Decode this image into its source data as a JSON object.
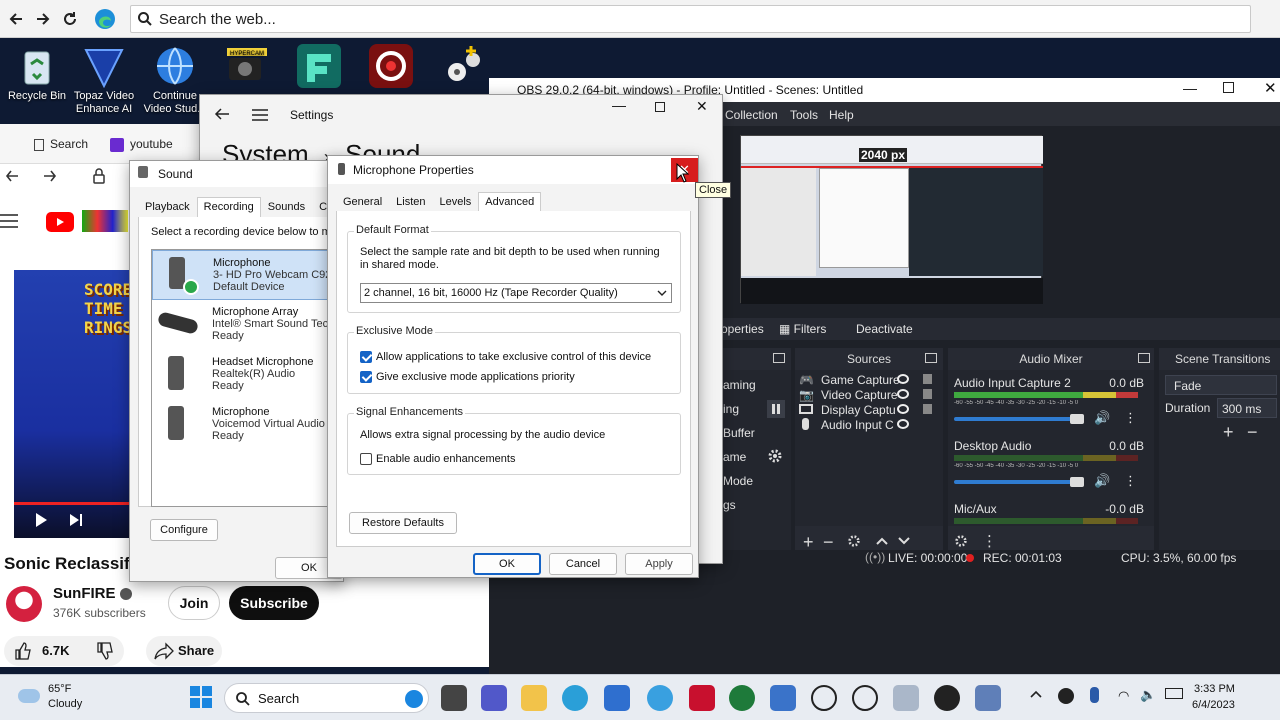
{
  "browser": {
    "search_placeholder": "Search the web..."
  },
  "desktop_icons": [
    {
      "label": "Recycle Bin"
    },
    {
      "label": "Topaz Video Enhance AI"
    },
    {
      "label": "Continue Video Stud..."
    },
    {
      "label": "HYPERCAM"
    },
    {
      "label": ""
    },
    {
      "label": ""
    },
    {
      "label": ""
    }
  ],
  "youtube": {
    "tab_search": "Search",
    "tab_youtube": "youtube",
    "video_title": "Sonic Reclassifi",
    "score_lines": [
      "SCORE",
      "TIME",
      "RINGS"
    ],
    "channel_name": "SunFIRE",
    "subscribers": "376K subscribers",
    "join_label": "Join",
    "subscribe_label": "Subscribe",
    "likes": "6.7K",
    "share_label": "Share"
  },
  "settings": {
    "title": "Settings",
    "breadcrumb_system": "System",
    "breadcrumb_sound": "Sound"
  },
  "sound_dialog": {
    "title": "Sound",
    "tabs": [
      "Playback",
      "Recording",
      "Sounds",
      "Commu"
    ],
    "instruction": "Select a recording device below to m",
    "devices": [
      {
        "name": "Microphone",
        "line2": "3- HD Pro Webcam C920",
        "status": "Default Device"
      },
      {
        "name": "Microphone Array",
        "line2": "Intel® Smart Sound Tec",
        "status": "Ready"
      },
      {
        "name": "Headset Microphone",
        "line2": "Realtek(R) Audio",
        "status": "Ready"
      },
      {
        "name": "Microphone",
        "line2": "Voicemod Virtual Audio",
        "status": "Ready"
      }
    ],
    "configure_label": "Configure",
    "ok_label": "OK"
  },
  "mic_props": {
    "title": "Microphone Properties",
    "close_tooltip": "Close",
    "tabs": [
      "General",
      "Listen",
      "Levels",
      "Advanced"
    ],
    "default_format_title": "Default Format",
    "default_format_desc": "Select the sample rate and bit depth to be used when running in shared mode.",
    "format_value": "2 channel, 16 bit, 16000 Hz (Tape Recorder Quality)",
    "exclusive_title": "Exclusive Mode",
    "exclusive_opt1": "Allow applications to take exclusive control of this device",
    "exclusive_opt2": "Give exclusive mode applications priority",
    "signal_title": "Signal Enhancements",
    "signal_desc": "Allows extra signal processing by the audio device",
    "signal_opt": "Enable audio enhancements",
    "restore_label": "Restore Defaults",
    "ok_label": "OK",
    "cancel_label": "Cancel",
    "apply_label": "Apply"
  },
  "obs": {
    "title": "OBS 29.0.2 (64-bit, windows) - Profile: Untitled - Scenes: Untitled",
    "menu": [
      "Collection",
      "Tools",
      "Help"
    ],
    "preview_label": "2040 px",
    "properties_label": "operties",
    "filters_label": "Filters",
    "deactivate_label": "Deactivate",
    "sources_title": "Sources",
    "sources": [
      "Game Capture",
      "Video Capture",
      "Display Captu",
      "Audio Input C"
    ],
    "mixer_title": "Audio Mixer",
    "mixer_channels": [
      {
        "name": "Audio Input Capture 2",
        "db": "0.0 dB"
      },
      {
        "name": "Desktop Audio",
        "db": "0.0 dB"
      },
      {
        "name": "Mic/Aux",
        "db": "-0.0 dB"
      }
    ],
    "meter_scale": "-60 -55 -50 -45 -40 -35 -30 -25 -20 -15 -10 -5 0",
    "transitions_title": "Scene Transitions",
    "transition_value": "Fade",
    "duration_label": "Duration",
    "duration_value": "300 ms",
    "controls": [
      "aming",
      "ing",
      "Buffer",
      "ame",
      "Mode",
      "gs"
    ],
    "status_live": "LIVE: 00:00:00",
    "status_rec": "REC: 00:01:03",
    "status_cpu": "CPU: 3.5%, 60.00 fps"
  },
  "taskbar": {
    "weather_temp": "65°F",
    "weather_desc": "Cloudy",
    "search_label": "Search",
    "time": "3:33 PM",
    "date": "6/4/2023"
  }
}
